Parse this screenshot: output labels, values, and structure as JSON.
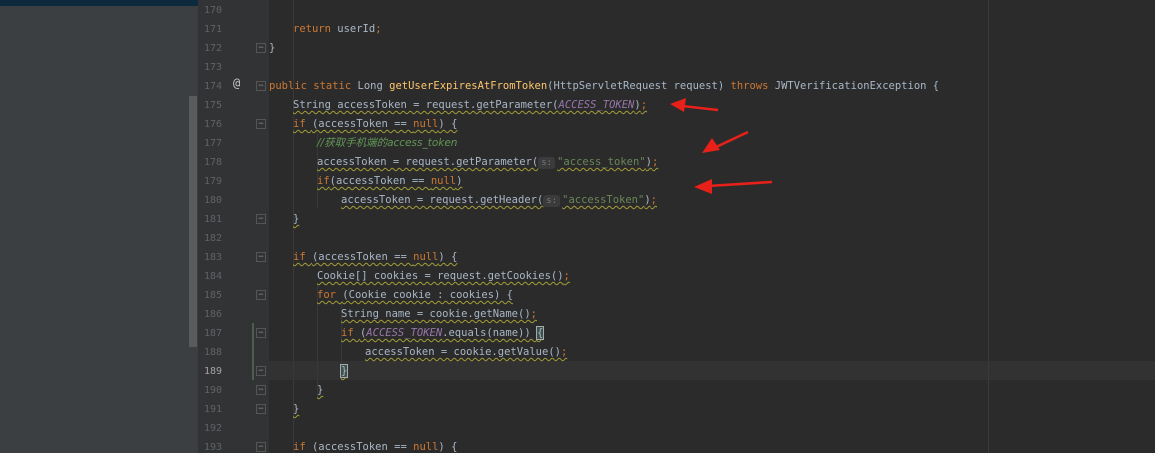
{
  "editor": {
    "current_line": "189",
    "lines": [
      {
        "no": "170",
        "indent": "",
        "parts": []
      },
      {
        "no": "171",
        "indent": "    ",
        "parts": [
          [
            "kw",
            "return"
          ],
          [
            "p",
            " userId"
          ],
          [
            "kw",
            ";"
          ]
        ]
      },
      {
        "no": "172",
        "indent": "",
        "parts": [
          [
            "p",
            "}"
          ]
        ]
      },
      {
        "no": "173",
        "indent": "",
        "parts": []
      },
      {
        "no": "174",
        "indent": "",
        "parts": [
          [
            "kw",
            "public static "
          ],
          [
            "p",
            "Long "
          ],
          [
            "fn",
            "getUserExpiresAtFromToken"
          ],
          [
            "p",
            "(HttpServletRequest request) "
          ],
          [
            "kw",
            "throws "
          ],
          [
            "p",
            "JWTVerificationException {"
          ]
        ]
      },
      {
        "no": "175",
        "indent": "    ",
        "parts": [
          [
            "p",
            "String accessToken = request.getParameter("
          ],
          [
            "const",
            "ACCESS_TOKEN"
          ],
          [
            "p",
            ")"
          ],
          [
            "kw",
            ";"
          ]
        ]
      },
      {
        "no": "176",
        "indent": "    ",
        "parts": [
          [
            "kw",
            "if "
          ],
          [
            "p",
            "(accessToken == "
          ],
          [
            "kw",
            "null"
          ],
          [
            "p",
            ") {"
          ]
        ]
      },
      {
        "no": "177",
        "indent": "        ",
        "parts": [
          [
            "cmt",
            "//获取手机端的access_token"
          ]
        ]
      },
      {
        "no": "178",
        "indent": "        ",
        "parts": [
          [
            "p",
            "accessToken = request.getParameter("
          ],
          [
            "hint",
            "s:"
          ],
          [
            "str",
            "\"access_token\""
          ],
          [
            "p",
            ")"
          ],
          [
            "kw",
            ";"
          ]
        ]
      },
      {
        "no": "179",
        "indent": "        ",
        "parts": [
          [
            "kw",
            "if"
          ],
          [
            "p",
            "(accessToken == "
          ],
          [
            "kw",
            "null"
          ],
          [
            "p",
            ")"
          ]
        ]
      },
      {
        "no": "180",
        "indent": "            ",
        "parts": [
          [
            "p",
            "accessToken = request.getHeader("
          ],
          [
            "hint",
            "s:"
          ],
          [
            "str",
            "\"accessToken\""
          ],
          [
            "p",
            ")"
          ],
          [
            "kw",
            ";"
          ]
        ]
      },
      {
        "no": "181",
        "indent": "    ",
        "parts": [
          [
            "p",
            "}"
          ]
        ]
      },
      {
        "no": "182",
        "indent": "",
        "parts": []
      },
      {
        "no": "183",
        "indent": "    ",
        "parts": [
          [
            "kw",
            "if "
          ],
          [
            "p",
            "(accessToken == "
          ],
          [
            "kw",
            "null"
          ],
          [
            "p",
            ") {"
          ]
        ]
      },
      {
        "no": "184",
        "indent": "        ",
        "parts": [
          [
            "p",
            "Cookie[] cookies = request.getCookies()"
          ],
          [
            "kw",
            ";"
          ]
        ]
      },
      {
        "no": "185",
        "indent": "        ",
        "parts": [
          [
            "kw",
            "for "
          ],
          [
            "p",
            "(Cookie cookie : cookies) {"
          ]
        ]
      },
      {
        "no": "186",
        "indent": "            ",
        "parts": [
          [
            "p",
            "String name = cookie.getName()"
          ],
          [
            "kw",
            ";"
          ]
        ]
      },
      {
        "no": "187",
        "indent": "            ",
        "parts": [
          [
            "kw",
            "if "
          ],
          [
            "p",
            "("
          ],
          [
            "const",
            "ACCESS_TOKEN"
          ],
          [
            "p",
            ".equals(name)) "
          ],
          [
            "brace",
            "{"
          ]
        ]
      },
      {
        "no": "188",
        "indent": "                ",
        "parts": [
          [
            "p",
            "accessToken = cookie.getValue()"
          ],
          [
            "kw",
            ";"
          ]
        ]
      },
      {
        "no": "189",
        "indent": "            ",
        "parts": [
          [
            "brace",
            "}"
          ],
          [
            "caret",
            ""
          ]
        ]
      },
      {
        "no": "190",
        "indent": "        ",
        "parts": [
          [
            "p",
            "}"
          ]
        ]
      },
      {
        "no": "191",
        "indent": "    ",
        "parts": [
          [
            "p",
            "}"
          ]
        ]
      },
      {
        "no": "192",
        "indent": "",
        "parts": []
      },
      {
        "no": "193",
        "indent": "    ",
        "parts": [
          [
            "kw",
            "if "
          ],
          [
            "p",
            "(accessToken == "
          ],
          [
            "kw",
            "null"
          ],
          [
            "p",
            ") {"
          ]
        ]
      }
    ]
  },
  "colors": {
    "background": "#2b2b2b",
    "gutter": "#313335",
    "keyword": "#cc7832",
    "method": "#ffc66d",
    "constant": "#9876aa",
    "string": "#6a8759",
    "annotation_arrow": "#e8201a"
  },
  "icons": {
    "override_marker": "at-sign-icon",
    "fold_marker": "fold-minus-icon"
  }
}
